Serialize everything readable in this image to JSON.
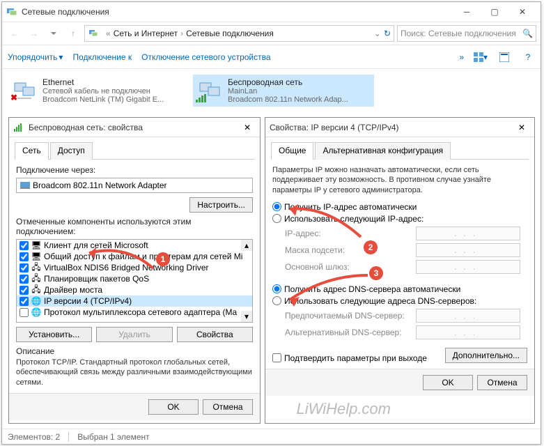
{
  "main_window": {
    "title": "Сетевые подключения",
    "nav_back_disabled": true,
    "nav_fwd_disabled": true,
    "breadcrumb": [
      "Сеть и Интернет",
      "Сетевые подключения"
    ],
    "search_placeholder": "Поиск: Сетевые подключения",
    "commands": {
      "organize": "Упорядочить",
      "connect": "Подключение к",
      "disable": "Отключение сетевого устройства"
    },
    "connections": [
      {
        "name": "Ethernet",
        "line1": "Сетевой кабель не подключен",
        "line2": "Broadcom NetLink (TM) Gigabit E...",
        "error": true
      },
      {
        "name": "Беспроводная сеть",
        "line1": "MainLan",
        "line2": "Broadcom 802.11n Network Adap...",
        "signal": true,
        "selected": true
      }
    ],
    "statusbar": {
      "count": "Элементов: 2",
      "selected": "Выбран 1 элемент"
    }
  },
  "prop_dialog": {
    "title": "Беспроводная сеть: свойства",
    "tabs": [
      "Сеть",
      "Доступ"
    ],
    "conn_via": "Подключение через:",
    "adapter": "Broadcom 802.11n Network Adapter",
    "configure": "Настроить...",
    "components_label": "Отмеченные компоненты используются этим подключением:",
    "components": [
      {
        "label": "Клиент для сетей Microsoft",
        "checked": true
      },
      {
        "label": "Общий доступ к файлам и принтерам для сетей Mi",
        "checked": true
      },
      {
        "label": "VirtualBox NDIS6 Bridged Networking Driver",
        "checked": true
      },
      {
        "label": "Планировщик пакетов QoS",
        "checked": true
      },
      {
        "label": "Драйвер моста",
        "checked": true
      },
      {
        "label": "IP версии 4 (TCP/IPv4)",
        "checked": true,
        "selected": true
      },
      {
        "label": "Протокол мультиплексора сетевого адаптера (Ma",
        "checked": false
      }
    ],
    "install": "Установить...",
    "remove": "Удалить",
    "properties": "Свойства",
    "desc_title": "Описание",
    "desc": "Протокол TCP/IP. Стандартный протокол глобальных сетей, обеспечивающий связь между различными взаимодействующими сетями.",
    "ok": "OK",
    "cancel": "Отмена"
  },
  "ipv4_dialog": {
    "title": "Свойства: IP версии 4 (TCP/IPv4)",
    "tabs": [
      "Общие",
      "Альтернативная конфигурация"
    ],
    "intro": "Параметры IP можно назначать автоматически, если сеть поддерживает эту возможность. В противном случае узнайте параметры IP у сетевого администратора.",
    "ip_auto": "Получить IP-адрес автоматически",
    "ip_manual": "Использовать следующий IP-адрес:",
    "ip_addr": "IP-адрес:",
    "mask": "Маска подсети:",
    "gateway": "Основной шлюз:",
    "dns_auto": "Получить адрес DNS-сервера автоматически",
    "dns_manual": "Использовать следующие адреса DNS-серверов:",
    "dns_pref": "Предпочитаемый DNS-сервер:",
    "dns_alt": "Альтернативный DNS-сервер:",
    "confirm": "Подтвердить параметры при выходе",
    "advanced": "Дополнительно...",
    "ok": "OK",
    "cancel": "Отмена"
  },
  "annotations": {
    "b1": "1",
    "b2": "2",
    "b3": "3"
  },
  "watermark": "LiWiHelp.com"
}
